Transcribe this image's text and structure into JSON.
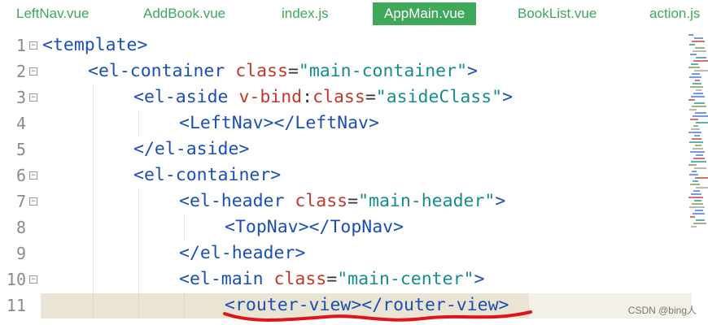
{
  "tabs": [
    {
      "label": "LeftNav.vue",
      "active": false
    },
    {
      "label": "AddBook.vue",
      "active": false
    },
    {
      "label": "index.js",
      "active": false
    },
    {
      "label": "AppMain.vue",
      "active": true
    },
    {
      "label": "BookList.vue",
      "active": false
    },
    {
      "label": "action.js",
      "active": false
    }
  ],
  "editor": {
    "current_line": 11,
    "lines": [
      {
        "num": "1",
        "indent": 0,
        "fold": "-",
        "tokens": [
          {
            "t": "tag",
            "v": "<template>"
          }
        ]
      },
      {
        "num": "2",
        "indent": 1,
        "fold": "-",
        "tokens": [
          {
            "t": "tag",
            "v": "<el-container "
          },
          {
            "t": "attr",
            "v": "class"
          },
          {
            "t": "punc",
            "v": "="
          },
          {
            "t": "str",
            "v": "\"main-container\""
          },
          {
            "t": "tag",
            "v": ">"
          }
        ]
      },
      {
        "num": "3",
        "indent": 2,
        "fold": "-",
        "tokens": [
          {
            "t": "tag",
            "v": "<el-aside "
          },
          {
            "t": "attr",
            "v": "v-bind"
          },
          {
            "t": "punc",
            "v": ":"
          },
          {
            "t": "attr",
            "v": "class"
          },
          {
            "t": "punc",
            "v": "="
          },
          {
            "t": "str",
            "v": "\"asideClass\""
          },
          {
            "t": "tag",
            "v": ">"
          }
        ]
      },
      {
        "num": "4",
        "indent": 3,
        "fold": "",
        "tokens": [
          {
            "t": "tag",
            "v": "<LeftNav></LeftNav>"
          }
        ]
      },
      {
        "num": "5",
        "indent": 2,
        "fold": "",
        "tokens": [
          {
            "t": "tag",
            "v": "</el-aside>"
          }
        ]
      },
      {
        "num": "6",
        "indent": 2,
        "fold": "-",
        "tokens": [
          {
            "t": "tag",
            "v": "<el-container>"
          }
        ]
      },
      {
        "num": "7",
        "indent": 3,
        "fold": "-",
        "tokens": [
          {
            "t": "tag",
            "v": "<el-header "
          },
          {
            "t": "attr",
            "v": "class"
          },
          {
            "t": "punc",
            "v": "="
          },
          {
            "t": "str",
            "v": "\"main-header\""
          },
          {
            "t": "tag",
            "v": ">"
          }
        ]
      },
      {
        "num": "8",
        "indent": 4,
        "fold": "",
        "tokens": [
          {
            "t": "tag",
            "v": "<TopNav></TopNav>"
          }
        ]
      },
      {
        "num": "9",
        "indent": 3,
        "fold": "",
        "tokens": [
          {
            "t": "tag",
            "v": "</el-header>"
          }
        ]
      },
      {
        "num": "10",
        "indent": 3,
        "fold": "-",
        "tokens": [
          {
            "t": "tag",
            "v": "<el-main "
          },
          {
            "t": "attr",
            "v": "class"
          },
          {
            "t": "punc",
            "v": "="
          },
          {
            "t": "str",
            "v": "\"main-center\""
          },
          {
            "t": "tag",
            "v": ">"
          }
        ]
      },
      {
        "num": "11",
        "indent": 4,
        "fold": "",
        "tokens": [
          {
            "t": "tag",
            "v": "<router-view></router-view>"
          }
        ]
      }
    ]
  },
  "colors": {
    "tab_active_bg": "#3fa85a",
    "tag": "#1a4fb5",
    "attr": "#c0392b",
    "string": "#168d8d",
    "current_line": "#e9e4d3",
    "annotation": "#e0151b"
  },
  "watermark": "CSDN @bing人"
}
